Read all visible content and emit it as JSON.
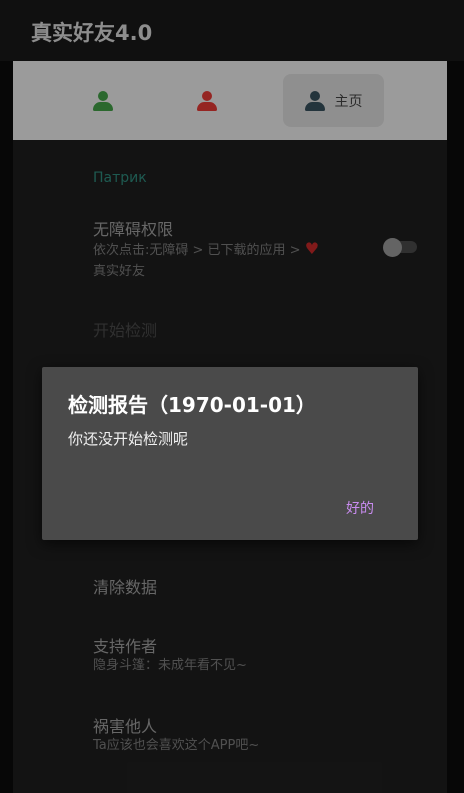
{
  "appbar": {
    "title": "真实好友4.0"
  },
  "tabs": [
    {
      "icon": "person-icon",
      "color": "#43a047"
    },
    {
      "icon": "person-icon",
      "color": "#e53935"
    },
    {
      "icon": "person-icon",
      "color": "#37505c",
      "label": "主页"
    }
  ],
  "content": {
    "section_header": "Патрик",
    "accessibility": {
      "title": "无障碍权限",
      "subtitle_line1": "依次点击:无障碍 > 已下载的应用 >",
      "heart": "♥",
      "subtitle_line2": "真实好友",
      "toggle_on": false
    },
    "start_detection": {
      "title": "开始检测"
    },
    "clear_data": {
      "title": "清除数据"
    },
    "support_author": {
      "title": "支持作者",
      "subtitle": "隐身斗篷：未成年看不见~"
    },
    "harm_others": {
      "title": "祸害他人",
      "subtitle": "Ta应该也会喜欢这个APP吧~"
    }
  },
  "dialog": {
    "title": "检测报告（1970-01-01）",
    "message": "你还没开始检测呢",
    "ok_label": "好的"
  }
}
